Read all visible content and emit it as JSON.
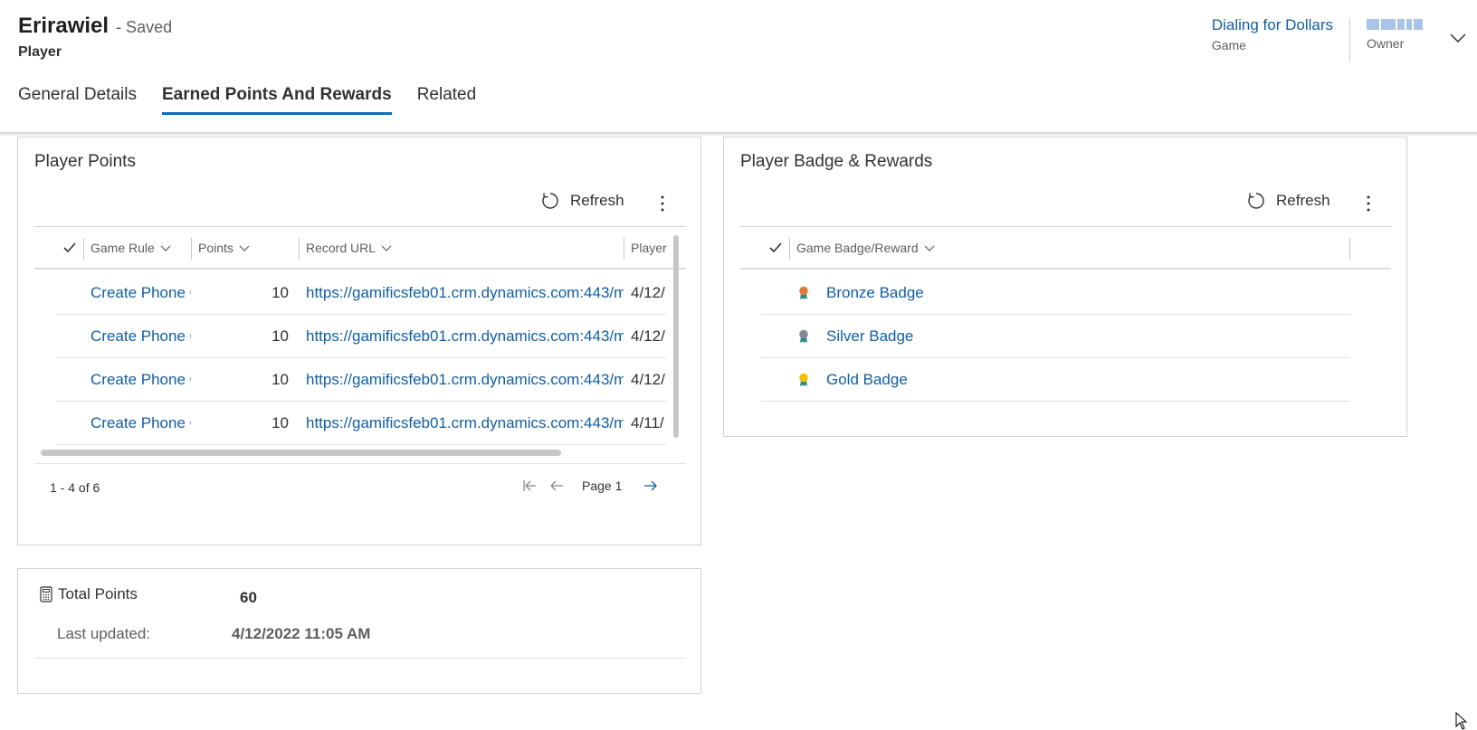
{
  "record": {
    "name": "Erirawiel",
    "status": "- Saved",
    "entity": "Player"
  },
  "header_fields": [
    {
      "value": "Dialing for Dollars",
      "label": "Game"
    },
    {
      "value": "",
      "label": "Owner"
    }
  ],
  "tabs": [
    {
      "label": "General Details",
      "active": false
    },
    {
      "label": "Earned Points And Rewards",
      "active": true
    },
    {
      "label": "Related",
      "active": false
    }
  ],
  "player_points": {
    "title": "Player Points",
    "refresh_label": "Refresh",
    "columns": [
      "Game Rule",
      "Points",
      "Record URL",
      "Player"
    ],
    "rows": [
      {
        "game_rule": "Create Phone C",
        "points": "10",
        "record_url": "https://gamificsfeb01.crm.dynamics.com:443/m",
        "player": "4/12/"
      },
      {
        "game_rule": "Create Phone C",
        "points": "10",
        "record_url": "https://gamificsfeb01.crm.dynamics.com:443/m",
        "player": "4/12/"
      },
      {
        "game_rule": "Create Phone C",
        "points": "10",
        "record_url": "https://gamificsfeb01.crm.dynamics.com:443/m",
        "player": "4/12/"
      },
      {
        "game_rule": "Create Phone C",
        "points": "10",
        "record_url": "https://gamificsfeb01.crm.dynamics.com:443/m",
        "player": "4/11/"
      }
    ],
    "pager": {
      "count": "1 - 4 of 6",
      "page": "Page 1"
    }
  },
  "badges": {
    "title": "Player Badge & Rewards",
    "refresh_label": "Refresh",
    "column": "Game Badge/Reward",
    "rows": [
      {
        "name": "Bronze Badge",
        "color": "#e07b39"
      },
      {
        "name": "Silver Badge",
        "color": "#7d8c99"
      },
      {
        "name": "Gold Badge",
        "color": "#f2c200"
      }
    ]
  },
  "totals": {
    "label": "Total Points",
    "value": "60",
    "updated_label": "Last updated:",
    "updated_value": "4/12/2022 11:05 AM"
  },
  "colors": {
    "accent": "#0f6cbd",
    "link": "#115ea3"
  }
}
